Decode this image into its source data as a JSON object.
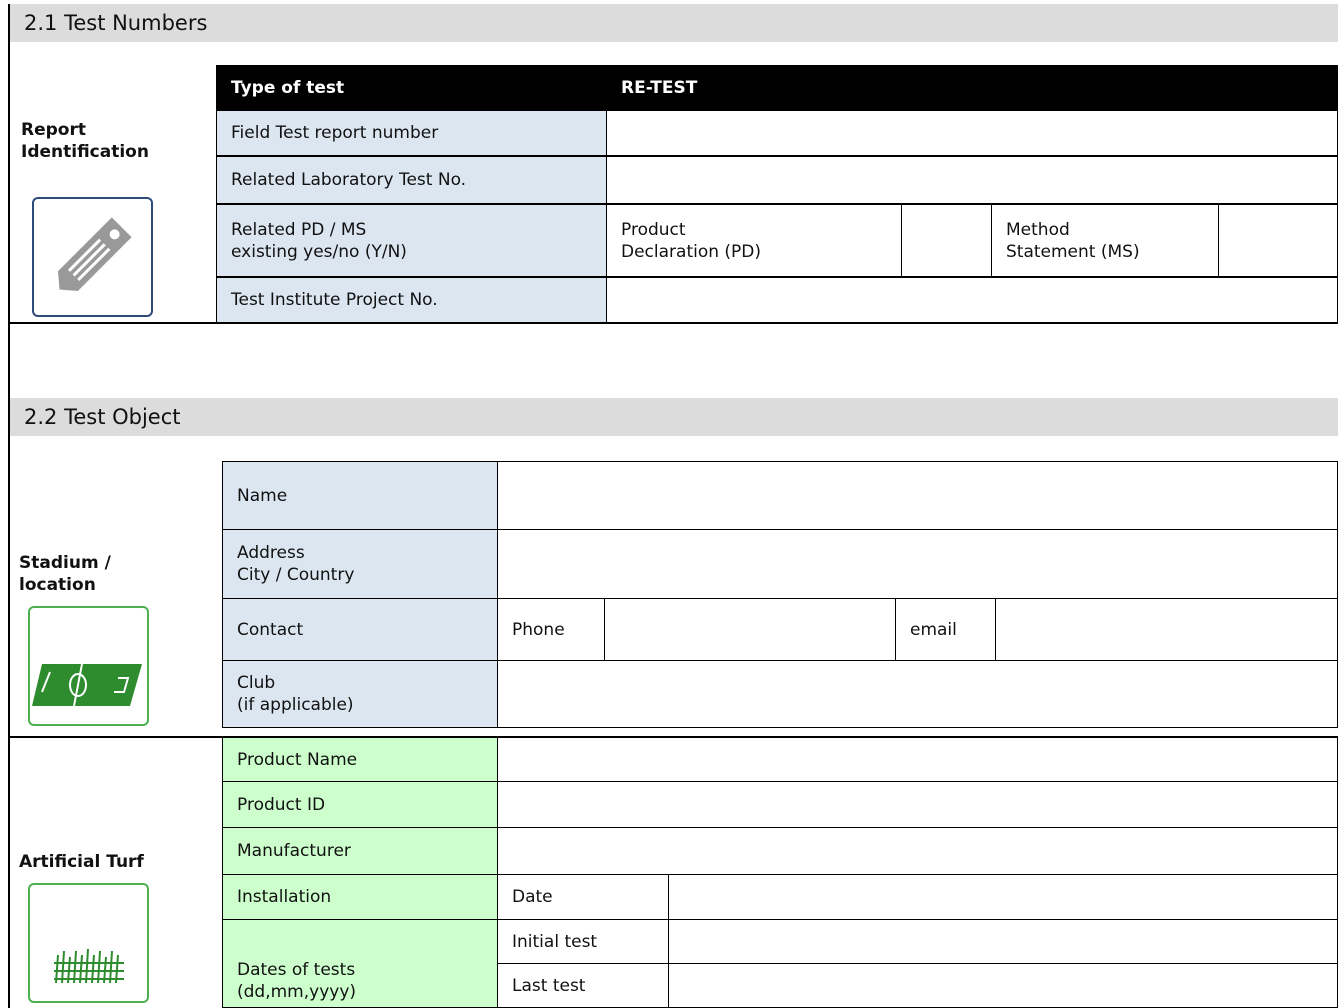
{
  "section1": {
    "title": "2.1 Test Numbers",
    "side_label": "Report\nIdentification",
    "icon": "price-tag-icon",
    "header": {
      "type_label": "Type of test",
      "type_value": "RE-TEST"
    },
    "rows": {
      "field_report": "Field Test report number",
      "lab_test": "Related Laboratory Test No.",
      "pd_ms": "Related PD / MS\nexisting yes/no (Y/N)",
      "product_decl": "Product\nDeclaration (PD)",
      "method_stmt": "Method\nStatement (MS)",
      "project_no": "Test Institute Project No."
    }
  },
  "section2": {
    "title": "2.2 Test Object",
    "stadium": {
      "side_label": "Stadium /\nlocation",
      "icon": "football-pitch-icon",
      "name": "Name",
      "address": "Address\nCity / Country",
      "contact": "Contact",
      "phone": "Phone",
      "email": "email",
      "club": "Club\n(if applicable)"
    },
    "turf": {
      "side_label": "Artificial Turf",
      "icon": "turf-grass-icon",
      "product_name": "Product Name",
      "product_id": "Product ID",
      "manufacturer": "Manufacturer",
      "installation": "Installation",
      "date": "Date",
      "dates_of_tests": "Dates of tests\n(dd,mm,yyyy)",
      "initial_test": "Initial test",
      "last_test": "Last test"
    }
  },
  "colors": {
    "header_bg": "#dcdcdc",
    "label_blue": "#dce6f1",
    "label_green": "#ccffcc",
    "icon_border_blue": "#2f4b7c",
    "icon_border_green": "#4caf50"
  }
}
